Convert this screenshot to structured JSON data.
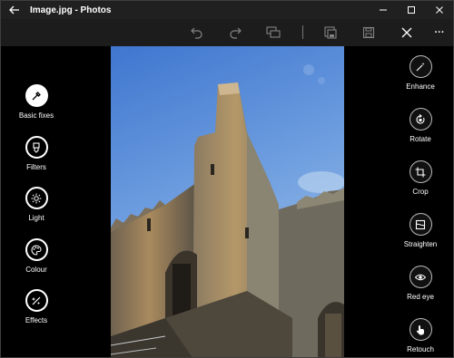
{
  "window": {
    "title": "Image.jpg - Photos"
  },
  "toolbar": {
    "undo_icon": "undo-icon",
    "redo_icon": "redo-icon",
    "compare_icon": "compare-icon",
    "save_copy_icon": "save-copy-icon",
    "save_icon": "save-icon",
    "close_icon": "close-icon",
    "more_label": "···"
  },
  "left_tools": [
    {
      "label": "Basic fixes",
      "icon": "wand-icon",
      "active": true
    },
    {
      "label": "Filters",
      "icon": "filter-icon",
      "active": false
    },
    {
      "label": "Light",
      "icon": "sun-icon",
      "active": false
    },
    {
      "label": "Colour",
      "icon": "palette-icon",
      "active": false
    },
    {
      "label": "Effects",
      "icon": "effects-icon",
      "active": false
    }
  ],
  "right_tools": [
    {
      "label": "Enhance",
      "icon": "magic-wand-icon"
    },
    {
      "label": "Rotate",
      "icon": "rotate-icon"
    },
    {
      "label": "Crop",
      "icon": "crop-icon"
    },
    {
      "label": "Straighten",
      "icon": "straighten-icon"
    },
    {
      "label": "Red eye",
      "icon": "eye-icon"
    },
    {
      "label": "Retouch",
      "icon": "retouch-icon"
    }
  ],
  "colors": {
    "titlebar": "#202020",
    "toolbar": "#1c1c1c",
    "background": "#000000",
    "sky": "#5d8fd8"
  }
}
